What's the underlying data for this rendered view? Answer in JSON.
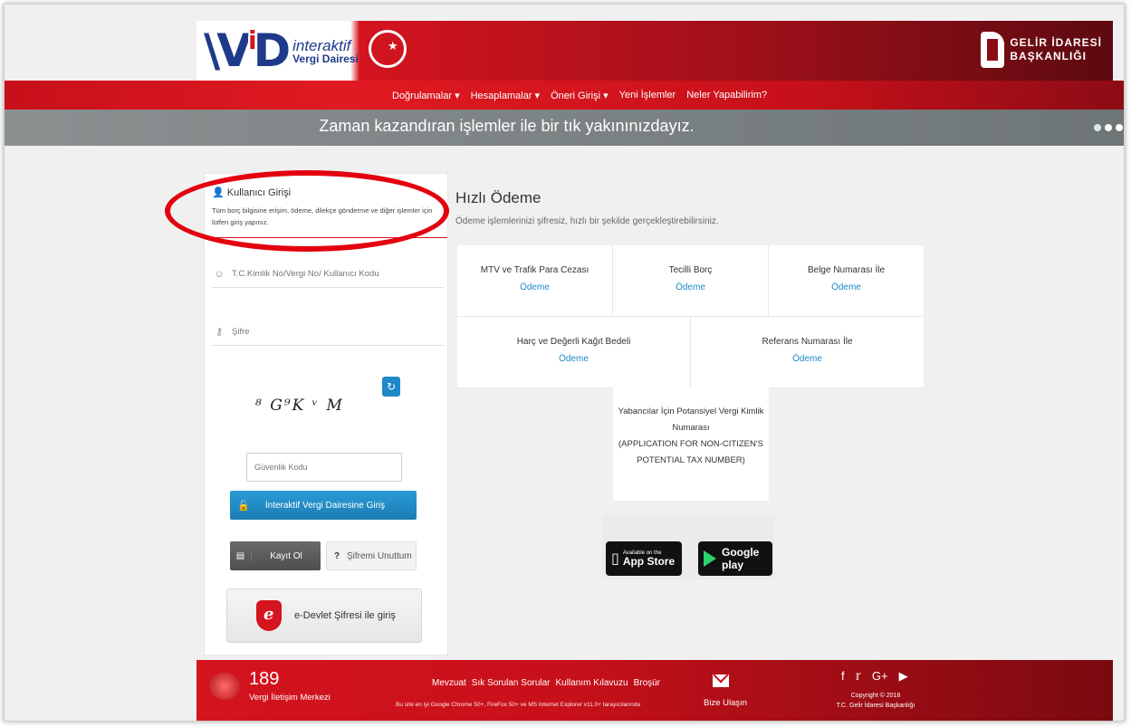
{
  "header": {
    "logo_line1": "interaktif",
    "logo_line2": "Vergi Dairesi",
    "gib_line1": "GELİR İDARESİ",
    "gib_line2": "BAŞKANLIĞI"
  },
  "nav": {
    "items": [
      "Doğrulamalar ▾",
      "Hesaplamalar ▾",
      "Öneri Girişi ▾",
      "Yeni İşlemler",
      "Neler Yapabilirim?"
    ]
  },
  "slogan": "Zaman kazandıran işlemler ile bir tık yakınınızdayız.",
  "login": {
    "title": "Kullanıcı Girişi",
    "description": "Tüm borç bilgisine erişim, ödeme, dilekçe gönderme ve diğer işlemler için lütfen giriş yapınız.",
    "id_placeholder": "T.C.Kimlik No/Vergi No/ Kullanıcı Kodu",
    "password_placeholder": "Şifre",
    "captcha_text": "⁸ G⁹K ᵛ M",
    "security_placeholder": "Güvenlik Kodu",
    "login_button": "İnteraktif Vergi Dairesine Giriş",
    "register_button": "Kayıt Ol",
    "forgot_button": "Şifremi Unuttum",
    "edevlet_button": "e-Devlet Şifresi ile giriş"
  },
  "quick_payment": {
    "title": "Hızlı Ödeme",
    "description": "Ödeme işlemlerinizi şifresiz, hızlı bir şekilde gerçekleştirebilirsiniz.",
    "row1": [
      {
        "title": "MTV ve Trafik Para Cezası",
        "link": "Ödeme"
      },
      {
        "title": "Tecilli Borç",
        "link": "Ödeme"
      },
      {
        "title": "Belge Numarası İle",
        "link": "Ödeme"
      }
    ],
    "row2": [
      {
        "title": "Harç ve Değerli Kağıt Bedeli",
        "link": "Ödeme"
      },
      {
        "title": "Referans Numarası İle",
        "link": "Ödeme"
      }
    ],
    "foreigner_line1": "Yabancılar İçin Potansiyel Vergi Kimlik Numarası",
    "foreigner_line2": "(APPLICATION FOR NON-CITIZEN'S POTENTIAL TAX NUMBER)"
  },
  "stores": {
    "app_small": "Available on the",
    "app_big": "App Store",
    "google_big": "Google play"
  },
  "footer": {
    "phone": "189",
    "phone_label": "Vergi İletişim Merkezi",
    "links": [
      "Mevzuat",
      "Sık Sorulan Sorular",
      "Kullanım Kılavuzu",
      "Broşür"
    ],
    "note": "Bu site en iyi Google Chrome 50+, FireFox 50+ ve MS Internet Explorer v11.0+ tarayıcılarında",
    "contact": "Bize Ulaşın",
    "copyright": "Copyright © 2018",
    "copyright2": "T.C. Gelir İdaresi Başkanlığı",
    "social_icons": [
      "facebook-icon",
      "twitter-icon",
      "googleplus-icon",
      "youtube-icon"
    ]
  },
  "colors": {
    "primary_red": "#d4141e",
    "dark_red": "#7a0a10",
    "link_blue": "#1e88c8",
    "annotation_oval": "#e3000f"
  }
}
